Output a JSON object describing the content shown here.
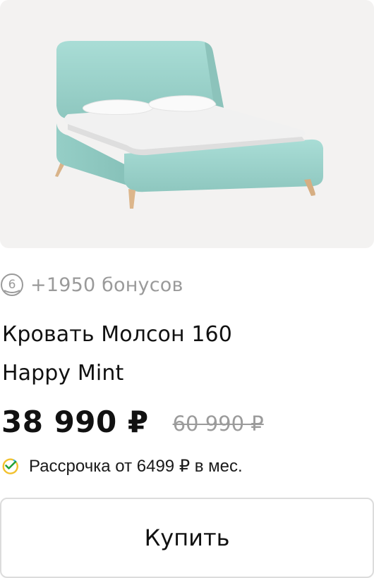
{
  "product": {
    "image_alt": "bed-image",
    "bonus": {
      "icon": "bonus-coin-icon",
      "icon_digit": "6",
      "text": "+1950 бонусов"
    },
    "title_lines": [
      "Кровать Молсон 160",
      "Happy Mint"
    ],
    "price": {
      "current": "38 990 ₽",
      "old": "60 990 ₽"
    },
    "installment": {
      "icon": "sber-check-icon",
      "text": "Рассрочка от 6499 ₽ в мес."
    },
    "buy_button": {
      "label": "Купить"
    }
  },
  "colors": {
    "background": "#ffffff",
    "image_background": "#f3f2f1",
    "bed_fabric": "#9fd3cc",
    "muted_text": "#9a9a9a",
    "button_border": "#dcdcdc"
  }
}
